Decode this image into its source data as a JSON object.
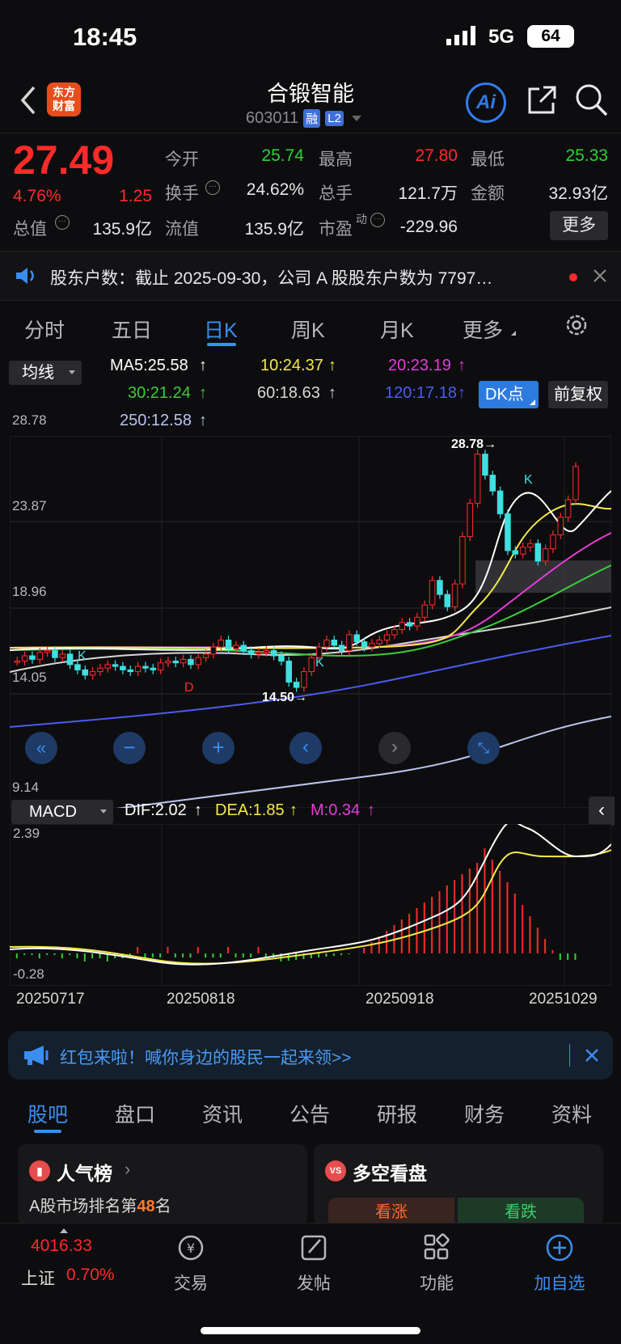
{
  "status": {
    "time": "18:45",
    "network": "5G",
    "battery": "64"
  },
  "header": {
    "logo": "东方\n财富",
    "logo_line1": "东方",
    "logo_line2": "财富",
    "title": "合锻智能",
    "code": "603011",
    "badge_rong": "融",
    "badge_l2": "L2",
    "ai_label": "Ai"
  },
  "quote": {
    "price": "27.49",
    "change_pct": "4.76%",
    "change": "1.25",
    "rows": [
      [
        {
          "label": "今开",
          "value": "25.74",
          "color": "green"
        },
        {
          "label": "最高",
          "value": "27.80",
          "color": "red"
        },
        {
          "label": "最低",
          "value": "25.33",
          "color": "green"
        }
      ],
      [
        {
          "label": "换手",
          "value": "24.62%",
          "color": "white"
        },
        {
          "label": "总手",
          "value": "121.7万",
          "color": "white"
        },
        {
          "label": "金额",
          "value": "32.93亿",
          "color": "white"
        }
      ]
    ],
    "total_value_label": "总值",
    "total_value": "135.9亿",
    "float_label": "流值",
    "float_value": "135.9亿",
    "pe_label": "市盈",
    "pe_super": "动",
    "pe_value": "-229.96",
    "more_button": "更多"
  },
  "notice": {
    "text": "股东户数：截止 2025-09-30，公司 A 股股东户数为 7797…"
  },
  "ktabs": {
    "tabs": [
      "分时",
      "五日",
      "日K",
      "周K",
      "月K",
      "更多"
    ],
    "active": 2
  },
  "indicators": {
    "ma_select": "均线",
    "ma5": "MA5:25.58",
    "ma10": "10:24.37",
    "ma20": "20:23.19",
    "ma30": "30:21.24",
    "ma60": "60:18.63",
    "ma120": "120:17.18",
    "ma250": "250:12.58",
    "dk_button": "DK点",
    "fuquan_button": "前复权",
    "colors": {
      "ma5": "#ffffff",
      "ma10": "#f5e94a",
      "ma20": "#e63cd8",
      "ma30": "#3ccc3c",
      "ma60": "#d8d8d8",
      "ma120": "#4b5cf0",
      "ma250": "#b8c4f0"
    }
  },
  "kchart": {
    "y_labels": [
      "28.78",
      "23.87",
      "18.96",
      "14.05",
      "9.14"
    ],
    "high_marker": "28.78",
    "low_marker": "14.50",
    "k_marks": [
      "K",
      "K",
      "K"
    ],
    "d_marks": [
      "D"
    ]
  },
  "macd": {
    "select": "MACD",
    "dif": "DIF:2.02",
    "dea": "DEA:1.85",
    "m": "M:0.34",
    "top": "2.39",
    "bottom": "-0.28",
    "dates": [
      "20250717",
      "20250818",
      "20250918",
      "20251029"
    ]
  },
  "ad": {
    "text": "红包来啦！喊你身边的股民一起来领>>"
  },
  "bottom_tabs": {
    "tabs": [
      "股吧",
      "盘口",
      "资讯",
      "公告",
      "研报",
      "财务",
      "资料"
    ],
    "active": 0
  },
  "cards": {
    "popularity_title": "人气榜",
    "popularity_text_prefix": "A股市场排名第",
    "popularity_rank": "48",
    "popularity_text_suffix": "名",
    "bullbear_title": "多空看盘",
    "bull_label": "看涨",
    "bear_label": "看跌"
  },
  "bottom_nav": {
    "index_value": "4016.33",
    "index_name": "上证",
    "index_change": "0.70%",
    "items": [
      "交易",
      "发帖",
      "功能",
      "加自选"
    ]
  }
}
